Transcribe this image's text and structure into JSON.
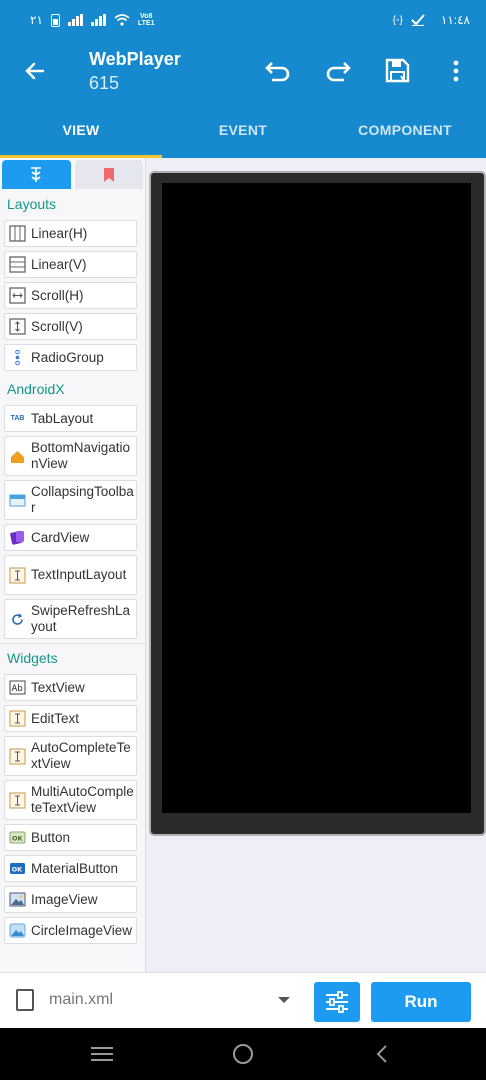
{
  "status": {
    "time": "١١:٤٨",
    "left_text": "٢١",
    "volte": "Vo8\nLTE1"
  },
  "app_bar": {
    "title": "WebPlayer",
    "subtitle": "615",
    "icons": [
      "back-arrow-icon",
      "undo-icon",
      "redo-icon",
      "save-icon",
      "more-vert-icon"
    ]
  },
  "tabs": [
    {
      "label": "VIEW",
      "active": true
    },
    {
      "label": "EVENT",
      "active": false
    },
    {
      "label": "COMPONENT",
      "active": false
    }
  ],
  "palette": {
    "sections": [
      {
        "title": "Layouts",
        "items": [
          {
            "label": "Linear(H)",
            "icon": "linear-h-icon"
          },
          {
            "label": "Linear(V)",
            "icon": "linear-v-icon"
          },
          {
            "label": "Scroll(H)",
            "icon": "scroll-h-icon"
          },
          {
            "label": "Scroll(V)",
            "icon": "scroll-v-icon"
          },
          {
            "label": "RadioGroup",
            "icon": "radiogroup-icon"
          }
        ]
      },
      {
        "title": "AndroidX",
        "items": [
          {
            "label": "TabLayout",
            "icon": "tab-icon"
          },
          {
            "label": "BottomNavigationView",
            "icon": "home-icon"
          },
          {
            "label": "CollapsingToolbar",
            "icon": "toolbar-icon"
          },
          {
            "label": "CardView",
            "icon": "card-icon"
          },
          {
            "label": "TextInputLayout",
            "icon": "text-input-icon"
          },
          {
            "label": "SwipeRefreshLayout",
            "icon": "refresh-icon"
          }
        ]
      },
      {
        "title": "Widgets",
        "items": [
          {
            "label": "TextView",
            "icon": "textview-icon"
          },
          {
            "label": "EditText",
            "icon": "edittext-icon"
          },
          {
            "label": "AutoCompleteTextView",
            "icon": "autocomplete-icon"
          },
          {
            "label": "MultiAutoCompleteTextView",
            "icon": "multi-autocomplete-icon"
          },
          {
            "label": "Button",
            "icon": "button-icon"
          },
          {
            "label": "MaterialButton",
            "icon": "material-button-icon"
          },
          {
            "label": "ImageView",
            "icon": "image-icon"
          },
          {
            "label": "CircleImageView",
            "icon": "circle-image-icon"
          }
        ]
      }
    ]
  },
  "bottom": {
    "file_name": "main.xml",
    "run_label": "Run"
  },
  "colors": {
    "primary": "#1689cf",
    "accent": "#1d9bf0",
    "tab_indicator": "#f4c430",
    "section_title": "#14978a"
  }
}
